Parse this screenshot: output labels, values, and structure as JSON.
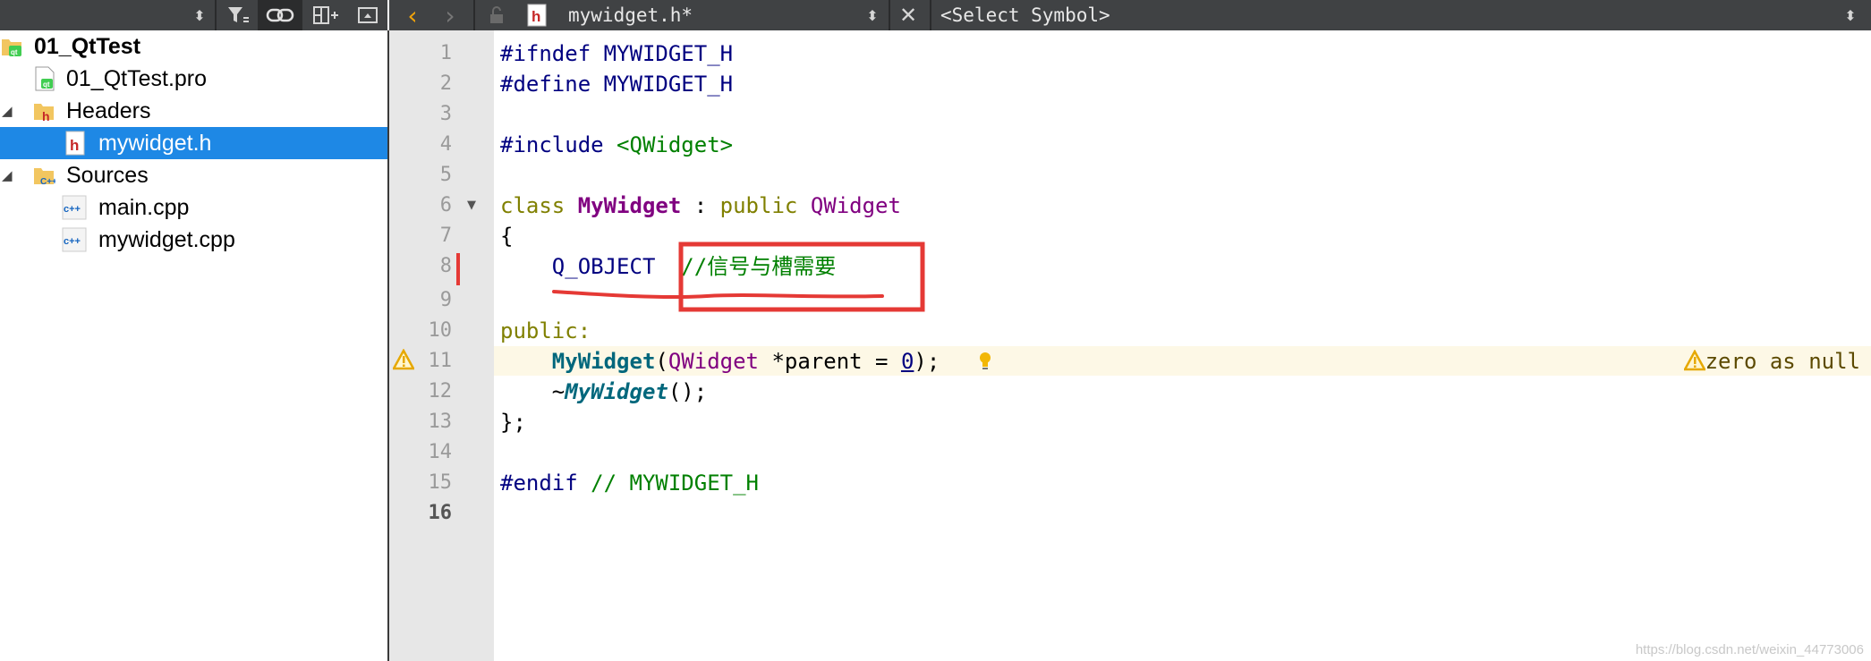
{
  "toolbar": {
    "left_icons": [
      "sort-arrows-icon",
      "filter-icon",
      "link-icon",
      "split-add-icon",
      "collapse-icon"
    ],
    "file_title": "mywidget.h*",
    "symbol_selector": "<Select Symbol>"
  },
  "project_tree": {
    "items": [
      {
        "label": "01_QtTest",
        "type": "project",
        "bold": true
      },
      {
        "label": "01_QtTest.pro",
        "type": "pro-file"
      },
      {
        "label": "Headers",
        "type": "folder-h",
        "expanded": true
      },
      {
        "label": "mywidget.h",
        "type": "header",
        "selected": true
      },
      {
        "label": "Sources",
        "type": "folder-cpp",
        "expanded": true
      },
      {
        "label": "main.cpp",
        "type": "cpp"
      },
      {
        "label": "mywidget.cpp",
        "type": "cpp"
      }
    ]
  },
  "editor": {
    "line_numbers": [
      "1",
      "2",
      "3",
      "4",
      "5",
      "6",
      "7",
      "8",
      "9",
      "10",
      "11",
      "12",
      "13",
      "14",
      "15",
      "16"
    ],
    "current_line": "16",
    "lines": {
      "l1": "#ifndef MYWIDGET_H",
      "l2": "#define MYWIDGET_H",
      "l4a": "#include ",
      "l4b": "<QWidget>",
      "l6a": "class ",
      "l6b": "MyWidget",
      "l6c": " : ",
      "l6d": "public",
      "l6e": " ",
      "l6f": "QWidget",
      "l7": "{",
      "l8a": "    ",
      "l8b": "Q_OBJECT",
      "l8c": "  ",
      "l8d": "//信号与槽需要",
      "l10": "public:",
      "l11a": "    ",
      "l11b": "MyWidget",
      "l11c": "(",
      "l11d": "QWidget",
      "l11e": " *parent = ",
      "l11f": "0",
      "l11g": ");",
      "l12a": "    ~",
      "l12b": "MyWidget",
      "l12c": "();",
      "l13": "};",
      "l15a": "#endif ",
      "l15b": "// MYWIDGET_H"
    },
    "warning_message": "zero as null",
    "annotation_color": "#e53935"
  },
  "watermark": "https://blog.csdn.net/weixin_44773006"
}
